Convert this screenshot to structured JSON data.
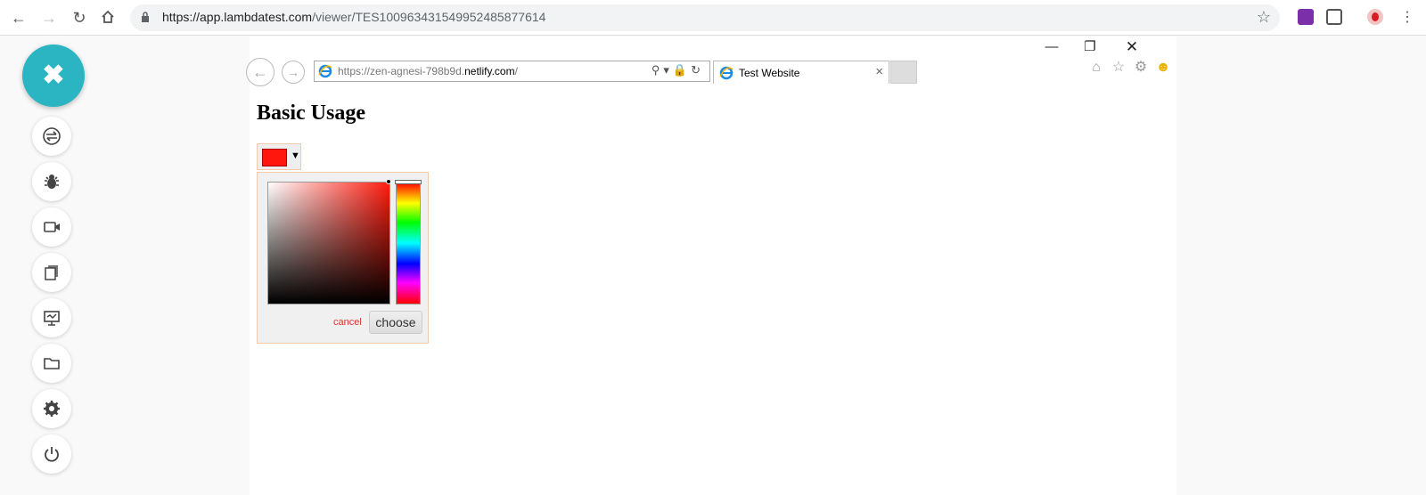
{
  "browser": {
    "url_host": "https://app.lambdatest.com",
    "url_path": "/viewer/TES100963431549952485877614",
    "extensions": [
      "onenote-icon",
      "bitwarden-icon",
      "profile-avatar"
    ]
  },
  "sidebar": {
    "close_label": "✖",
    "tools": [
      {
        "name": "switch-icon"
      },
      {
        "name": "bug-icon"
      },
      {
        "name": "video-icon"
      },
      {
        "name": "screenshots-icon"
      },
      {
        "name": "display-icon"
      },
      {
        "name": "folder-icon"
      },
      {
        "name": "settings-icon"
      },
      {
        "name": "power-icon"
      }
    ],
    "accent": "#2bb5c2"
  },
  "ie": {
    "url_prefix": "https://zen-agnesi-798b9d.",
    "url_host": "netlify.com",
    "url_suffix": "/",
    "tab_title": "Test Website",
    "tab_close": "×"
  },
  "page": {
    "heading": "Basic Usage",
    "picker": {
      "selected_color": "#ff160c",
      "arrow": "▼",
      "cancel_label": "cancel",
      "choose_label": "choose"
    }
  }
}
